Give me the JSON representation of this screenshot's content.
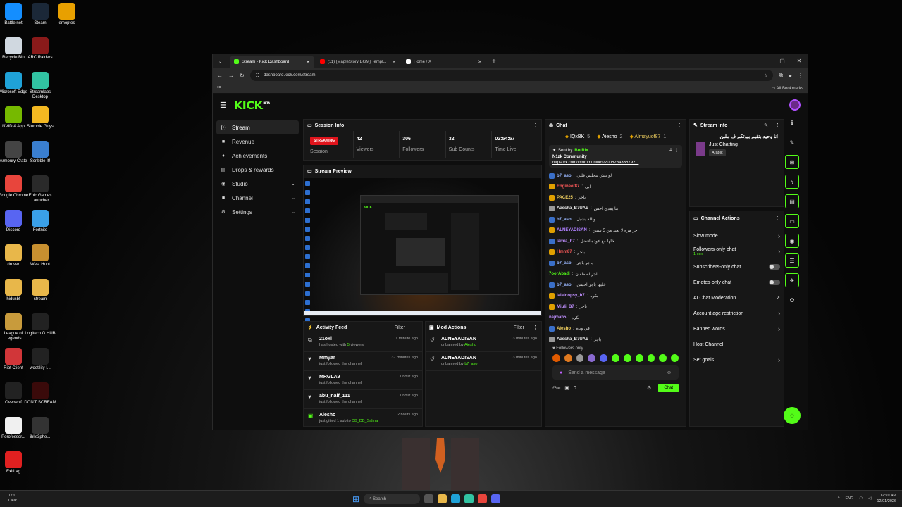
{
  "desktop": {
    "icons": [
      {
        "label": "Battle.net",
        "color": "#148eff"
      },
      {
        "label": "Steam",
        "color": "#1b2838"
      },
      {
        "label": "emoptes",
        "color": "#e8a000"
      },
      {
        "label": "Recycle Bin",
        "color": "#d0d8e0"
      },
      {
        "label": "ARC Raiders",
        "color": "#8a1a1a"
      },
      {
        "label": "Microsoft Edge",
        "color": "#1fa2d8"
      },
      {
        "label": "Streamlabs Desktop",
        "color": "#31c3a2"
      },
      {
        "label": "NVIDIA App",
        "color": "#76b900"
      },
      {
        "label": "Stumble Guys",
        "color": "#f3b821"
      },
      {
        "label": "Armoury Crate",
        "color": "#444"
      },
      {
        "label": "Scribble It!",
        "color": "#3a7fd0"
      },
      {
        "label": "Google Chrome",
        "color": "#e8453c"
      },
      {
        "label": "Epic Games Launcher",
        "color": "#2a2a2a"
      },
      {
        "label": "Discord",
        "color": "#5865f2"
      },
      {
        "label": "Fortnite",
        "color": "#3aa0e8"
      },
      {
        "label": "drover",
        "color": "#e8b74a"
      },
      {
        "label": "West Hunt",
        "color": "#c89030"
      },
      {
        "label": "hidusbf",
        "color": "#e8b74a"
      },
      {
        "label": "stream",
        "color": "#e8b74a"
      },
      {
        "label": "League of Legends",
        "color": "#c89b3c"
      },
      {
        "label": "Logitech G HUB",
        "color": "#222"
      },
      {
        "label": "Riot Client",
        "color": "#d13639"
      },
      {
        "label": "wootility-l...",
        "color": "#222"
      },
      {
        "label": "Overwolf",
        "color": "#222"
      },
      {
        "label": "DON'T SCREAM",
        "color": "#3a0a0a"
      },
      {
        "label": "Porofessor...",
        "color": "#f0f0f0"
      },
      {
        "label": "iblis3phe...",
        "color": "#333"
      },
      {
        "label": "ExitLag",
        "color": "#e02020"
      }
    ]
  },
  "browser": {
    "tabs": [
      {
        "label": "Stream - Kick Dashboard",
        "icon_color": "#53fc18"
      },
      {
        "label": "(11) [MapleStory BGM] Templ...",
        "icon_color": "#ff0000"
      },
      {
        "label": "Home / X",
        "icon_color": "#ffffff"
      }
    ],
    "url": "dashboard.kick.com/stream",
    "all_bookmarks": "All Bookmarks"
  },
  "app": {
    "logo": "KICK",
    "logo_tag": "BETA",
    "nav": [
      {
        "label": "Stream",
        "icon": "stream-icon",
        "glyph": "(•)"
      },
      {
        "label": "Revenue",
        "icon": "revenue-icon",
        "glyph": "■"
      },
      {
        "label": "Achievements",
        "icon": "trophy-icon",
        "glyph": "♦"
      },
      {
        "label": "Drops & rewards",
        "icon": "drops-icon",
        "glyph": "▤"
      },
      {
        "label": "Studio",
        "icon": "studio-icon",
        "glyph": "◉"
      },
      {
        "label": "Channel",
        "icon": "channel-icon",
        "glyph": "■"
      },
      {
        "label": "Settings",
        "icon": "settings-icon",
        "glyph": "⚙"
      }
    ],
    "session": {
      "title": "Session Info",
      "status": "STREAMING",
      "session_label": "Session",
      "stats": [
        {
          "value": "42",
          "label": "Viewers"
        },
        {
          "value": "306",
          "label": "Followers"
        },
        {
          "value": "32",
          "label": "Sub Counts"
        },
        {
          "value": "02:54:57",
          "label": "Time Live"
        }
      ]
    },
    "preview": {
      "title": "Stream Preview"
    },
    "activity": {
      "title": "Activity Feed",
      "filter": "Filter",
      "items": [
        {
          "name": "21oxi",
          "pre": "has hosted with ",
          "hl": "5",
          "post": " viewers!",
          "time": "1 minute ago",
          "icon": "host-icon",
          "glyph": "⧉"
        },
        {
          "name": "Mmyar",
          "pre": "just followed the channel",
          "hl": "",
          "post": "",
          "time": "37 minutes ago",
          "icon": "heart-icon",
          "glyph": "♥"
        },
        {
          "name": "MRGLA9",
          "pre": "just followed the channel",
          "hl": "",
          "post": "",
          "time": "1 hour ago",
          "icon": "heart-icon",
          "glyph": "♥"
        },
        {
          "name": "abu_naif_111",
          "pre": "just followed the channel",
          "hl": "",
          "post": "",
          "time": "1 hour ago",
          "icon": "heart-icon",
          "glyph": "♥"
        },
        {
          "name": "Aiesho",
          "pre": "just gifted 1 sub to ",
          "hl": "DB_DB_Salma",
          "post": "",
          "time": "2 hours ago",
          "icon": "gift-icon",
          "glyph": "▣"
        }
      ]
    },
    "mod": {
      "title": "Mod Actions",
      "filter": "Filter",
      "items": [
        {
          "name": "ALNEYADISAN",
          "action": "unbanned by ",
          "by": "Aiesho",
          "time": "3 minutes ago"
        },
        {
          "name": "ALNEYADISAN",
          "action": "unbanned by ",
          "by": "b7_aso",
          "time": "3 minutes ago"
        }
      ]
    },
    "chat": {
      "title": "Chat",
      "top": [
        {
          "name": "IQxBK",
          "count": "5"
        },
        {
          "name": "Aiesho",
          "count": "2"
        },
        {
          "name": "Almayuof87",
          "count": "1"
        }
      ],
      "pinned": {
        "sent_by": "Sent by",
        "bot": "BotRix",
        "title": "N1zk Community",
        "link": "https://x.com/i/communities/2005284335792..."
      },
      "messages": [
        {
          "user": "b7_aso",
          "color": "#9ab8ff",
          "text": "لو بتش بتحلس قلبي",
          "badge": "#3a6fc8"
        },
        {
          "user": "Engineer87",
          "color": "#ff5a5a",
          "text": "ابي",
          "badge": "#e0a000"
        },
        {
          "user": "PACE25",
          "color": "#f0d060",
          "text": "باجر",
          "badge": "#e0a000"
        },
        {
          "user": "Aaesha_B7UAE",
          "color": "#eaeaea",
          "text": "ما يمدي احس",
          "badge": "#999"
        },
        {
          "user": "b7_aso",
          "color": "#9ab8ff",
          "text": "والله يشيل",
          "badge": "#3a6fc8"
        },
        {
          "user": "ALNEYADISAN",
          "color": "#b080ff",
          "text": "اخر مره لا تعيد من 5 سنين",
          "badge": "#e0a000"
        },
        {
          "user": "lamia_b7",
          "color": "#c090ff",
          "text": "خلها مع عوده افضل",
          "badge": "#3a6fc8"
        },
        {
          "user": "Hmm87",
          "color": "#ff5a5a",
          "text": "باجر",
          "badge": "#e0a000"
        },
        {
          "user": "b7_aso",
          "color": "#9ab8ff",
          "text": "باجر باجر",
          "badge": "#3a6fc8"
        },
        {
          "user": "7oorAbadi",
          "color": "#53fc18",
          "text": "باجر اصطفان",
          "badge": ""
        },
        {
          "user": "b7_aso",
          "color": "#9ab8ff",
          "text": "خليها باجر احسن",
          "badge": "#3a6fc8"
        },
        {
          "user": "lalaloopsy_b7",
          "color": "#c090ff",
          "text": "بكره",
          "badge": "#e0a000"
        },
        {
          "user": "Miuli_B7",
          "color": "#c090ff",
          "text": "باجر",
          "badge": "#e0a000"
        },
        {
          "user": "najmah5",
          "color": "#c090ff",
          "text": "بكره",
          "badge": ""
        },
        {
          "user": "Aiesho",
          "color": "#f0d060",
          "text": "في وياه",
          "badge": "#3a6fc8"
        },
        {
          "user": "Aaesha_B7UAE",
          "color": "#eaeaea",
          "text": "باجر",
          "badge": "#999"
        }
      ],
      "followers_only": "Followers only",
      "emote_colors": [
        "#e05a00",
        "#e07a20",
        "#999",
        "#8a6ad0",
        "#5865f2",
        "#53fc18",
        "#53fc18",
        "#53fc18",
        "#53fc18",
        "#53fc18",
        "#53fc18"
      ],
      "placeholder": "Send a message",
      "counter": "0",
      "send": "Chat"
    },
    "stream_info": {
      "title": "Stream Info",
      "stream_title": "انا وحيد بتقيم بيوتكم ف ملبن",
      "category": "Just Chatting",
      "lang": "Arabic"
    },
    "channel_actions": {
      "title": "Channel Actions",
      "items": [
        {
          "label": "Slow mode",
          "type": "arrow",
          "sub": ""
        },
        {
          "label": "Followers-only chat",
          "type": "arrow",
          "sub": "1 min"
        },
        {
          "label": "Subscribers-only chat",
          "type": "toggle",
          "sub": ""
        },
        {
          "label": "Emotes-only chat",
          "type": "toggle",
          "sub": ""
        },
        {
          "label": "AI Chat Moderation",
          "type": "external",
          "sub": ""
        },
        {
          "label": "Account age restriction",
          "type": "arrow",
          "sub": ""
        },
        {
          "label": "Banned words",
          "type": "arrow",
          "sub": ""
        },
        {
          "label": "Host Channel",
          "type": "none",
          "sub": ""
        },
        {
          "label": "Set goals",
          "type": "arrow",
          "sub": ""
        }
      ]
    }
  },
  "taskbar": {
    "temp": "17°C",
    "weather": "Clear",
    "search": "Search",
    "lang": "ENG",
    "time": "12:59 AM",
    "date": "12/01/2026"
  }
}
